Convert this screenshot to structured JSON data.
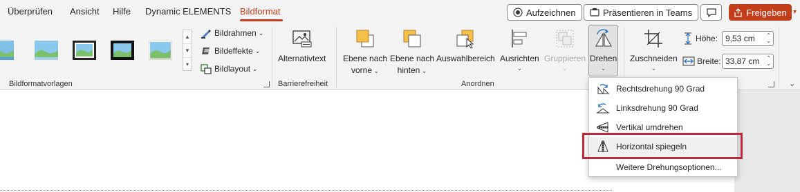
{
  "tabs": [
    "Überprüfen",
    "Ansicht",
    "Hilfe",
    "Dynamic ELEMENTS",
    "Bildformat"
  ],
  "active_tab": "Bildformat",
  "title_buttons": {
    "record": "Aufzeichnen",
    "present_teams": "Präsentieren in Teams",
    "share": "Freigeben"
  },
  "ribbon": {
    "styles_group_label": "Bildformatvorlagen",
    "style_commands": [
      "Bildrahmen",
      "Bildeffekte",
      "Bildlayout"
    ],
    "alt_text_label": "Alternativtext",
    "accessibility_group_label": "Barrierefreiheit",
    "arrange_group_label": "Anordnen",
    "arrange_buttons": {
      "bring_forward": [
        "Ebene nach",
        "vorne"
      ],
      "send_backward": [
        "Ebene nach",
        "hinten"
      ],
      "selection_pane": "Auswahlbereich",
      "align": "Ausrichten",
      "group": "Gruppieren",
      "rotate": "Drehen"
    },
    "crop_label": "Zuschneiden",
    "height_label": "Höhe:",
    "height_value": "9,53 cm",
    "width_label": "Breite:",
    "width_value": "33,87 cm"
  },
  "rotate_menu": {
    "items": [
      {
        "label": "Rechtsdrehung 90 Grad",
        "icon": "rotate-right-icon"
      },
      {
        "label": "Linksdrehung 90 Grad",
        "icon": "rotate-left-icon"
      },
      {
        "label": "Vertikal umdrehen",
        "icon": "flip-vertical-icon"
      },
      {
        "label": "Horizontal spiegeln",
        "icon": "flip-horizontal-icon"
      },
      {
        "label": "Weitere Drehungsoptionen...",
        "icon": ""
      }
    ],
    "highlighted_item": "Horizontal spiegeln"
  },
  "colors": {
    "accent": "#c43e1c",
    "highlight_border": "#c0283c"
  }
}
